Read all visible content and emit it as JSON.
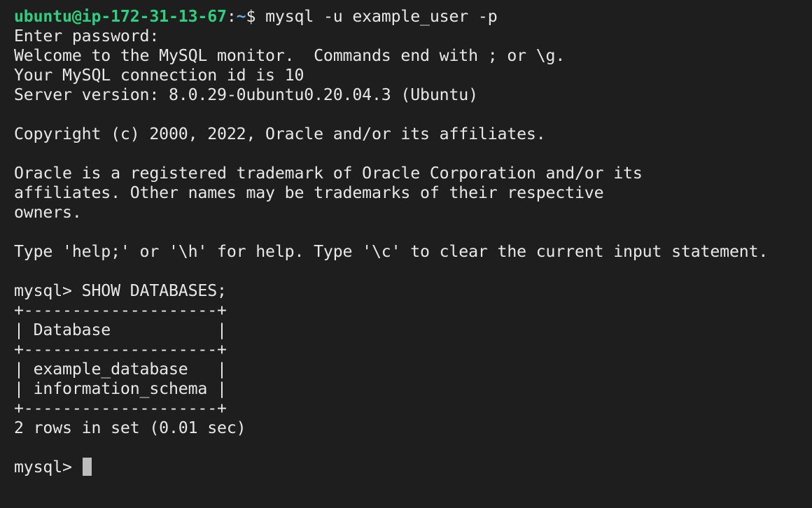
{
  "colors": {
    "background": "#1e1e1e",
    "text": "#e8e8e8",
    "prompt_host": "#2fcf7f",
    "prompt_path": "#6aa7e6",
    "cursor": "#bdbdbd"
  },
  "shell": {
    "user_host": "ubuntu@ip-172-31-13-67",
    "separator": ":",
    "path": "~",
    "dollar": "$ ",
    "command": "mysql -u example_user -p"
  },
  "output": [
    "Enter password:",
    "Welcome to the MySQL monitor.  Commands end with ; or \\g.",
    "Your MySQL connection id is 10",
    "Server version: 8.0.29-0ubuntu0.20.04.3 (Ubuntu)",
    "",
    "Copyright (c) 2000, 2022, Oracle and/or its affiliates.",
    "",
    "Oracle is a registered trademark of Oracle Corporation and/or its",
    "affiliates. Other names may be trademarks of their respective",
    "owners.",
    "",
    "Type 'help;' or '\\h' for help. Type '\\c' to clear the current input statement.",
    "",
    "mysql> SHOW DATABASES;"
  ],
  "result_table": {
    "border": "+--------------------+",
    "header": "| Database           |",
    "rows": [
      "| example_database   |",
      "| information_schema |"
    ]
  },
  "summary": "2 rows in set (0.01 sec)",
  "mysql_prompt": "mysql> "
}
